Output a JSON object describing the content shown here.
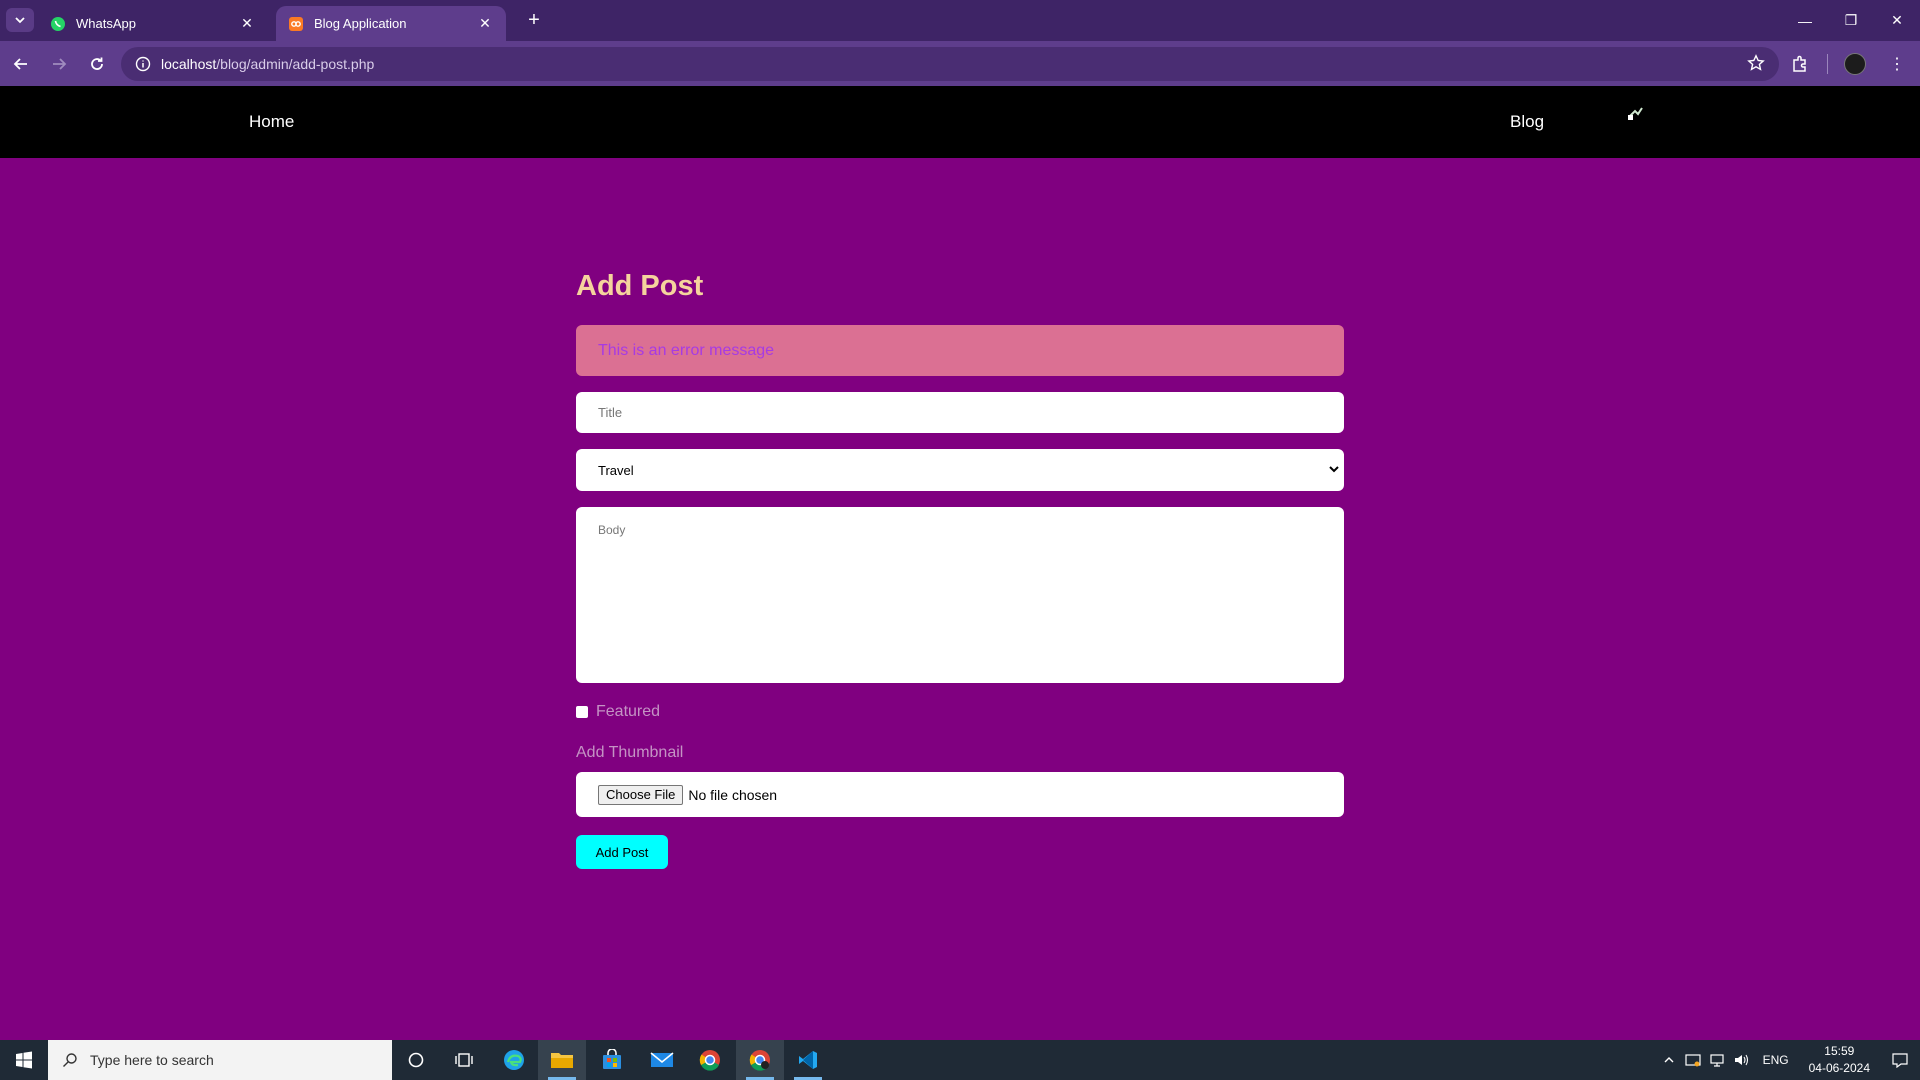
{
  "browser": {
    "tabs": [
      {
        "title": "WhatsApp",
        "icon": "whatsapp-icon",
        "active": false
      },
      {
        "title": "Blog Application",
        "icon": "blog-favicon-icon",
        "active": true
      }
    ],
    "url_host": "localhost",
    "url_path": "/blog/admin/add-post.php"
  },
  "site_nav": {
    "home_label": "Home",
    "blog_label": "Blog"
  },
  "form": {
    "heading": "Add Post",
    "error_message": "This is an error message",
    "title_placeholder": "Title",
    "category_selected": "Travel",
    "body_placeholder": "Body",
    "featured_label": "Featured",
    "thumbnail_label": "Add Thumbnail",
    "choose_file_label": "Choose File",
    "no_file_label": "No file chosen",
    "submit_label": "Add Post"
  },
  "taskbar": {
    "search_placeholder": "Type here to search",
    "language": "ENG",
    "time": "15:59",
    "date": "04-06-2024"
  },
  "colors": {
    "page_bg": "#800080",
    "heading": "#f5d39d",
    "error_bg": "#db7093",
    "error_text": "#a63be3",
    "submit_bg": "#00ffff"
  }
}
